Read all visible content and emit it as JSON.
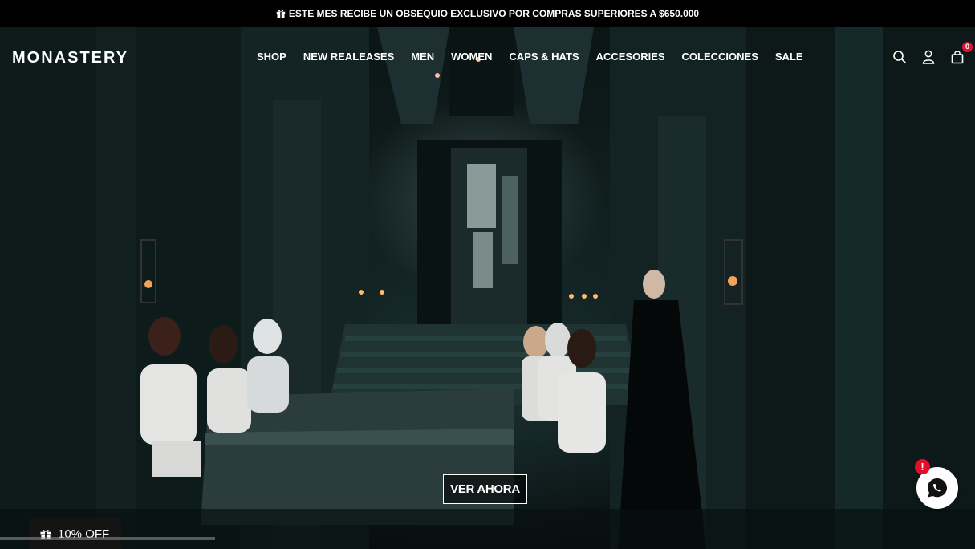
{
  "announcement": {
    "text": "ESTE MES RECIBE UN OBSEQUIO EXCLUSIVO POR COMPRAS SUPERIORES A $650.000",
    "icon": "gift-icon"
  },
  "brand": {
    "logo_text": "MONASTERY"
  },
  "nav": {
    "items": [
      {
        "label": "SHOP"
      },
      {
        "label": "NEW REALEASES"
      },
      {
        "label": "MEN"
      },
      {
        "label": "WOMEN"
      },
      {
        "label": "CAPS & HATS"
      },
      {
        "label": "ACCESORIES"
      },
      {
        "label": "COLECCIONES"
      },
      {
        "label": "SALE"
      }
    ]
  },
  "header_icons": {
    "search": "search-icon",
    "account": "user-icon",
    "cart": "bag-icon",
    "cart_count": "0"
  },
  "hero": {
    "cta_label": "VER AHORA"
  },
  "chat": {
    "alert": "!",
    "icon": "whatsapp-icon"
  },
  "discount_tab": {
    "label": "10% OFF",
    "icon": "gift-icon"
  },
  "colors": {
    "badge": "#e0123a",
    "background": "#000000",
    "text": "#ffffff"
  }
}
